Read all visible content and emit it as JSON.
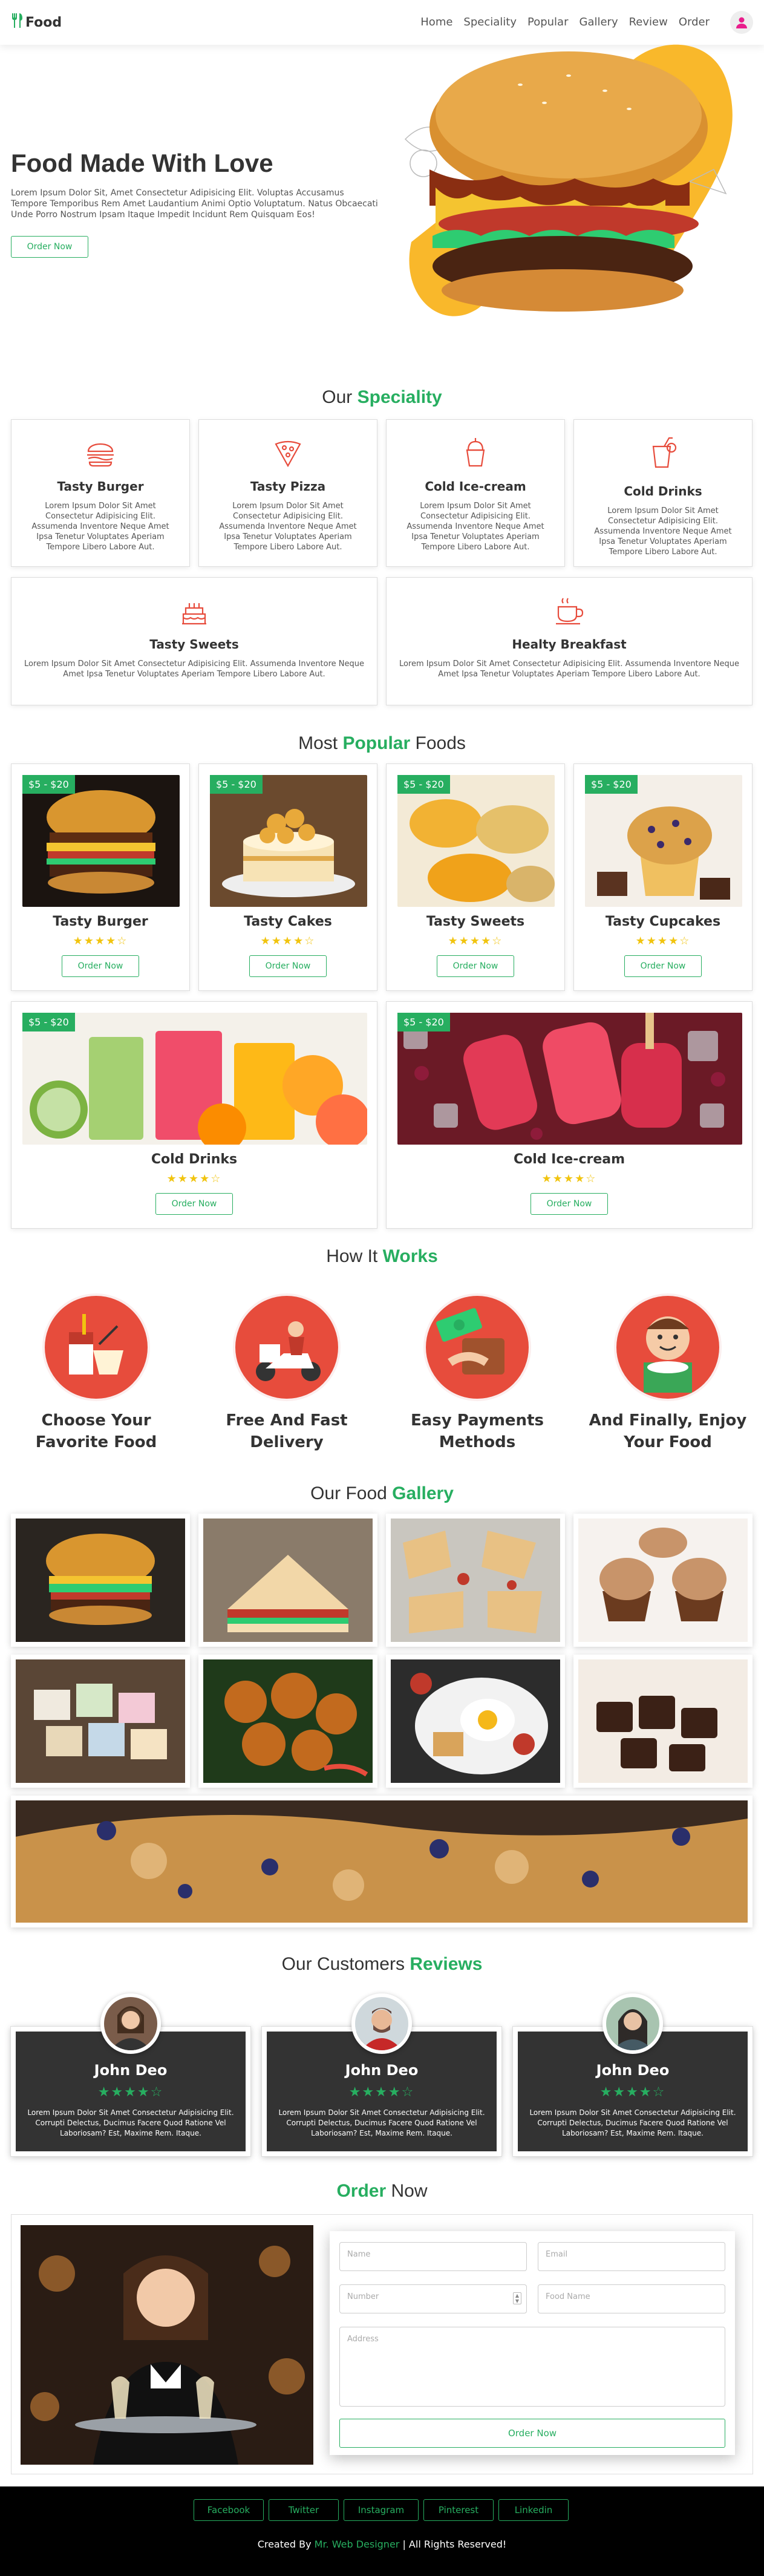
{
  "header": {
    "logo": "Food",
    "nav": [
      "Home",
      "Speciality",
      "Popular",
      "Gallery",
      "Review",
      "Order"
    ]
  },
  "hero": {
    "title": "Food Made With Love",
    "text": "Lorem Ipsum Dolor Sit, Amet Consectetur Adipisicing Elit. Voluptas Accusamus Tempore Temporibus Rem Amet Laudantium Animi Optio Voluptatum. Natus Obcaecati Unde Porro Nostrum Ipsam Itaque Impedit Incidunt Rem Quisquam Eos!",
    "button": "Order Now"
  },
  "speciality": {
    "heading_a": "Our",
    "heading_b": "Speciality",
    "items": [
      {
        "title": "Tasty Burger",
        "text": "Lorem Ipsum Dolor Sit Amet Consectetur Adipisicing Elit. Assumenda Inventore Neque Amet Ipsa Tenetur Voluptates Aperiam Tempore Libero Labore Aut."
      },
      {
        "title": "Tasty Pizza",
        "text": "Lorem Ipsum Dolor Sit Amet Consectetur Adipisicing Elit. Assumenda Inventore Neque Amet Ipsa Tenetur Voluptates Aperiam Tempore Libero Labore Aut."
      },
      {
        "title": "Cold Ice-cream",
        "text": "Lorem Ipsum Dolor Sit Amet Consectetur Adipisicing Elit. Assumenda Inventore Neque Amet Ipsa Tenetur Voluptates Aperiam Tempore Libero Labore Aut."
      },
      {
        "title": "Cold Drinks",
        "text": "Lorem Ipsum Dolor Sit Amet Consectetur Adipisicing Elit. Assumenda Inventore Neque Amet Ipsa Tenetur Voluptates Aperiam Tempore Libero Labore Aut."
      },
      {
        "title": "Tasty Sweets",
        "text": "Lorem Ipsum Dolor Sit Amet Consectetur Adipisicing Elit. Assumenda Inventore Neque Amet Ipsa Tenetur Voluptates Aperiam Tempore Libero Labore Aut."
      },
      {
        "title": "Healty Breakfast",
        "text": "Lorem Ipsum Dolor Sit Amet Consectetur Adipisicing Elit. Assumenda Inventore Neque Amet Ipsa Tenetur Voluptates Aperiam Tempore Libero Labore Aut."
      }
    ]
  },
  "popular": {
    "heading_a": "Most",
    "heading_b": "Popular",
    "heading_c": "Foods",
    "price": "$5 - $20",
    "button": "Order Now",
    "rating": "4 of 5",
    "items": [
      "Tasty Burger",
      "Tasty Cakes",
      "Tasty Sweets",
      "Tasty Cupcakes",
      "Cold Drinks",
      "Cold Ice-cream"
    ]
  },
  "steps": {
    "heading_a": "How It",
    "heading_b": "Works",
    "items": [
      "Choose Your Favorite Food",
      "Free And Fast Delivery",
      "Easy Payments Methods",
      "And Finally, Enjoy Your Food"
    ]
  },
  "gallery": {
    "heading_a": "Our Food",
    "heading_b": "Gallery"
  },
  "reviews": {
    "heading_a": "Our Customers",
    "heading_b": "Reviews",
    "rating": "4 of 5",
    "items": [
      {
        "name": "John Deo",
        "text": "Lorem Ipsum Dolor Sit Amet Consectetur Adipisicing Elit. Corrupti Delectus, Ducimus Facere Quod Ratione Vel Laboriosam? Est, Maxime Rem. Itaque."
      },
      {
        "name": "John Deo",
        "text": "Lorem Ipsum Dolor Sit Amet Consectetur Adipisicing Elit. Corrupti Delectus, Ducimus Facere Quod Ratione Vel Laboriosam? Est, Maxime Rem. Itaque."
      },
      {
        "name": "John Deo",
        "text": "Lorem Ipsum Dolor Sit Amet Consectetur Adipisicing Elit. Corrupti Delectus, Ducimus Facere Quod Ratione Vel Laboriosam? Est, Maxime Rem. Itaque."
      }
    ]
  },
  "order": {
    "heading_a": "Order",
    "heading_b": "Now",
    "fields": {
      "name": "Name",
      "email": "Email",
      "number": "Number",
      "food": "Food Name",
      "address": "Address"
    },
    "button": "Order Now"
  },
  "footer": {
    "social": [
      "Facebook",
      "Twitter",
      "Instagram",
      "Pinterest",
      "Linkedin"
    ],
    "credit_a": "Created By",
    "credit_b": "Mr. Web Designer",
    "credit_c": "| All Rights Reserved!"
  },
  "colors": {
    "accent": "#27ae60",
    "star": "#f1c40f",
    "red": "#e74c3c",
    "footer": "#000000"
  }
}
